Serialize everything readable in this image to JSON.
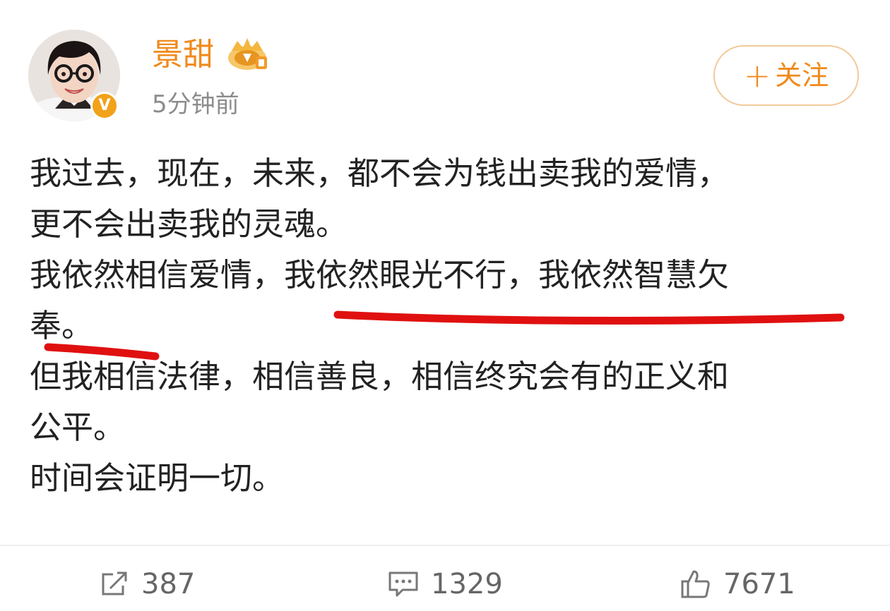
{
  "post": {
    "username": "景甜",
    "timestamp": "5分钟前",
    "follow_label": "关注",
    "body_lines": [
      "我过去，现在，未来，都不会为钱出卖我的爱情，",
      "更不会出卖我的灵魂。",
      "我依然相信爱情，我依然眼光不行，我依然智慧欠",
      "奉。",
      "但我相信法律，相信善良，相信终究会有的正义和",
      "公平。",
      "时间会证明一切。"
    ]
  },
  "actions": {
    "repost_count": "387",
    "comment_count": "1329",
    "like_count": "7671"
  },
  "colors": {
    "accent": "#f08a1c",
    "annotation": "#e01010",
    "text": "#222222",
    "muted": "#8c8c8c"
  },
  "icons": [
    "verified-v-icon",
    "vip-crown-icon",
    "plus-icon",
    "repost-icon",
    "comment-icon",
    "thumbs-up-icon"
  ]
}
